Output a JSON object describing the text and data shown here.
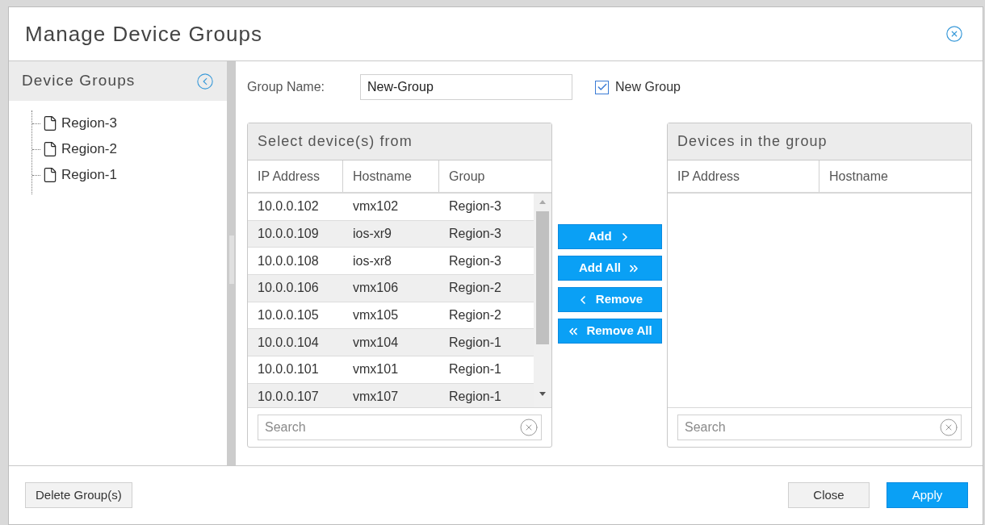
{
  "dialog": {
    "title": "Manage Device Groups"
  },
  "sidebar": {
    "title": "Device Groups",
    "items": [
      {
        "label": "Region-3"
      },
      {
        "label": "Region-2"
      },
      {
        "label": "Region-1"
      }
    ]
  },
  "form": {
    "group_name_label": "Group Name:",
    "group_name_value": "New-Group",
    "new_group": {
      "label": "New Group",
      "checked": true
    }
  },
  "source_panel": {
    "title": "Select device(s) from",
    "columns": [
      "IP Address",
      "Hostname",
      "Group"
    ],
    "rows": [
      [
        "10.0.0.102",
        "vmx102",
        "Region-3"
      ],
      [
        "10.0.0.109",
        "ios-xr9",
        "Region-3"
      ],
      [
        "10.0.0.108",
        "ios-xr8",
        "Region-3"
      ],
      [
        "10.0.0.106",
        "vmx106",
        "Region-2"
      ],
      [
        "10.0.0.105",
        "vmx105",
        "Region-2"
      ],
      [
        "10.0.0.104",
        "vmx104",
        "Region-1"
      ],
      [
        "10.0.0.101",
        "vmx101",
        "Region-1"
      ],
      [
        "10.0.0.107",
        "vmx107",
        "Region-1"
      ]
    ],
    "search_placeholder": "Search"
  },
  "transfer_buttons": [
    {
      "kind": "add",
      "label": "Add"
    },
    {
      "kind": "add_all",
      "label": "Add All"
    },
    {
      "kind": "remove",
      "label": "Remove"
    },
    {
      "kind": "remove_all",
      "label": "Remove All"
    }
  ],
  "target_panel": {
    "title": "Devices in the group",
    "columns": [
      "IP Address",
      "Hostname"
    ],
    "search_placeholder": "Search"
  },
  "footer": {
    "left_button": "Delete Group(s)",
    "buttons": [
      {
        "kind": "secondary",
        "label": "Close"
      },
      {
        "kind": "primary",
        "label": "Apply"
      }
    ]
  }
}
